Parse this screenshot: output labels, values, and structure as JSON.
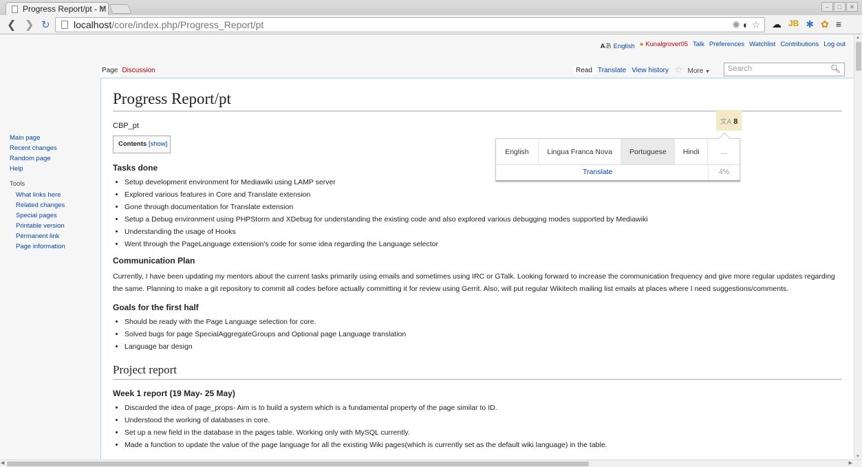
{
  "browser": {
    "tab_title": "Progress Report/pt - M",
    "tab_close": "×",
    "url_host": "localhost",
    "url_path": "/core/index.php/Progress_Report/pt",
    "window_controls": [
      "–",
      "□",
      "✕"
    ]
  },
  "personal_tools": {
    "language": "English",
    "username": "Kunalgrover05",
    "links": [
      "Talk",
      "Preferences",
      "Watchlist",
      "Contributions",
      "Log out"
    ]
  },
  "page_tabs": {
    "page": "Page",
    "discussion": "Discussion"
  },
  "view_tabs": {
    "read": "Read",
    "translate": "Translate",
    "history": "View history",
    "more": "More"
  },
  "search": {
    "placeholder": "Search"
  },
  "sidebar": {
    "navigation": [
      "Main page",
      "Recent changes",
      "Random page",
      "Help"
    ],
    "tools_heading": "Tools",
    "tools": [
      "What links here",
      "Related changes",
      "Special pages",
      "Printable version",
      "Permanent link",
      "Page information"
    ]
  },
  "article": {
    "title": "Progress Report/pt",
    "subtitle": "CBP_pt",
    "toc_title": "Contents",
    "toc_toggle": "[show]",
    "language_count": "8",
    "languages": [
      "English",
      "Lingua Franca Nova",
      "Portuguese",
      "Hindi",
      "..."
    ],
    "selected_language": "Portuguese",
    "translate_label": "Translate",
    "translate_percent": "4%",
    "sections": {
      "tasks_done": {
        "heading": "Tasks done",
        "items": [
          "Setup development environment for Mediawiki using LAMP server",
          "Explored various features in Core and Translate extension",
          "Gone through documentation for Translate extension",
          "Setup a Debug environment using PHPStorm and XDebug for understanding the existing code and also explored various debugging modes supported by Mediawiki",
          "Understanding the usage of Hooks",
          "Went through the PageLanguage extension's code for some idea regarding the Language selector"
        ]
      },
      "communication": {
        "heading": "Communication Plan",
        "text": "Currently, I have been updating my mentors about the current tasks primarily using emails and sometimes using IRC or GTalk. Looking forward to increase the communication frequency and give more regular updates regarding the same. Planning to make a git repository to commit all codes before actually committing it for review using Gerrit. Also, will put regular Wikitech mailing list emails at places where I need suggestions/comments."
      },
      "goals": {
        "heading": "Goals for the first half",
        "items": [
          "Should be ready with the Page Language selection for core.",
          "Solved bugs for page SpecialAggregateGroups and Optional page Language translation",
          "Language bar design"
        ]
      },
      "project_report": {
        "heading": "Project report"
      },
      "week1": {
        "heading": "Week 1 report (19 May- 25 May)",
        "items": [
          "Discarded the idea of page_props- Aim is to build a system which is a fundamental property of the page similar to ID.",
          "Understood the working of databases in core.",
          "Set up a new field in the database in the pages table. Working only with MySQL currently.",
          "Made a function to update the value of the page language for all the existing Wiki pages(which is currently set as the default wiki language) in the table."
        ]
      }
    }
  },
  "colors": {
    "link": "#0645ad",
    "content_border": "#a7d7f9",
    "count_badge": "#f3e9c7",
    "selected_language_bg": "#eaeaea"
  }
}
